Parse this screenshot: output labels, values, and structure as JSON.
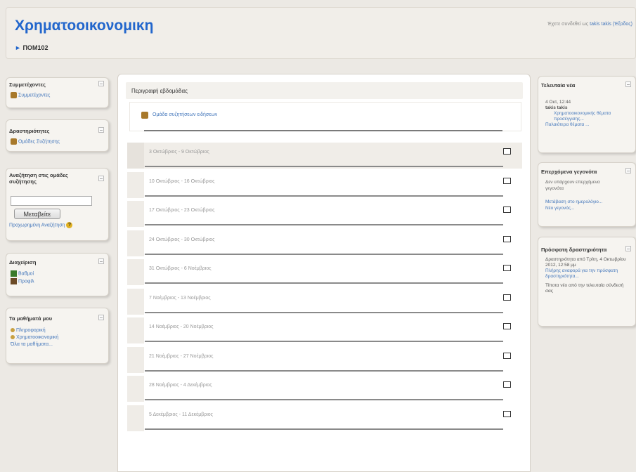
{
  "header": {
    "site_title": "Χρηματοοικονομικη",
    "login_prefix": "Έχετε συνδεθεί ως",
    "login_user": "takis takis",
    "logout_label": "(Έξοδος)",
    "breadcrumb_arrow": "►",
    "breadcrumb_item": "ΠΟΜ102"
  },
  "left_blocks": {
    "participants": {
      "title": "Συμμετέχοντες",
      "link": "Συμμετέχοντες"
    },
    "activities": {
      "title": "Δραστηριότητες",
      "link": "Ομάδες Συζήτησης"
    },
    "forum_search": {
      "title": "Αναζήτηση στις ομάδες συζήτησης",
      "button": "Μεταβείτε",
      "advanced": "Προχωρημένη Αναζήτηση",
      "help": "?"
    },
    "admin": {
      "title": "Διαχείριση",
      "grades": "Βαθμοί",
      "profile": "Προφίλ"
    },
    "my_courses": {
      "title": "Τα μαθήματά μου",
      "course1": "Πληροφορική",
      "course2": "Χρηματοοικονομική",
      "all": "Όλα τα μαθήματα..."
    }
  },
  "main": {
    "title": "Περιγραφή εβδομάδας",
    "news_forum": "Ομάδα συζητήσεων ειδήσεων",
    "weeks": [
      {
        "label": "3 Οκτώβριος - 9 Οκτώβριος"
      },
      {
        "label": "10 Οκτώβριος - 16 Οκτώβριος"
      },
      {
        "label": "17 Οκτώβριος - 23 Οκτώβριος"
      },
      {
        "label": "24 Οκτώβριος - 30 Οκτώβριος"
      },
      {
        "label": "31 Οκτώβριος - 6 Νοέμβριος"
      },
      {
        "label": "7 Νοέμβριος - 13 Νοέμβριος"
      },
      {
        "label": "14 Νοέμβριος - 20 Νοέμβριος"
      },
      {
        "label": "21 Νοέμβριος - 27 Νοέμβριος"
      },
      {
        "label": "28 Νοέμβριος - 4 Δεκέμβριος"
      },
      {
        "label": "5 Δεκέμβριος - 11 Δεκέμβριος"
      }
    ]
  },
  "right_blocks": {
    "news": {
      "title": "Τελευταία νέα",
      "date": "4 Οκτ, 12:44",
      "author": "takis takis",
      "post": "Χρηματοοικονομικής θέματα προσέγγισης...",
      "older": "Παλαιότερα θέματα ..."
    },
    "events": {
      "title": "Επερχόμενα γεγονότα",
      "none": "Δεν υπάρχουν επερχόμενα γεγονότα",
      "calendar": "Μετάβαση στο ημερολόγιο...",
      "new_event": "Νέο γεγονός..."
    },
    "recent": {
      "title": "Πρόσφατη δραστηριότητα",
      "since": "Δραστηριότητα από Τρίτη, 4 Οκτωβρίου 2012, 12:58 μμ",
      "full_report": "Πλήρης αναφορά για την πρόσφατη δραστηριότητα...",
      "nothing": "Τίποτα νέο από την τελευταία σύνδεσή σας"
    }
  }
}
